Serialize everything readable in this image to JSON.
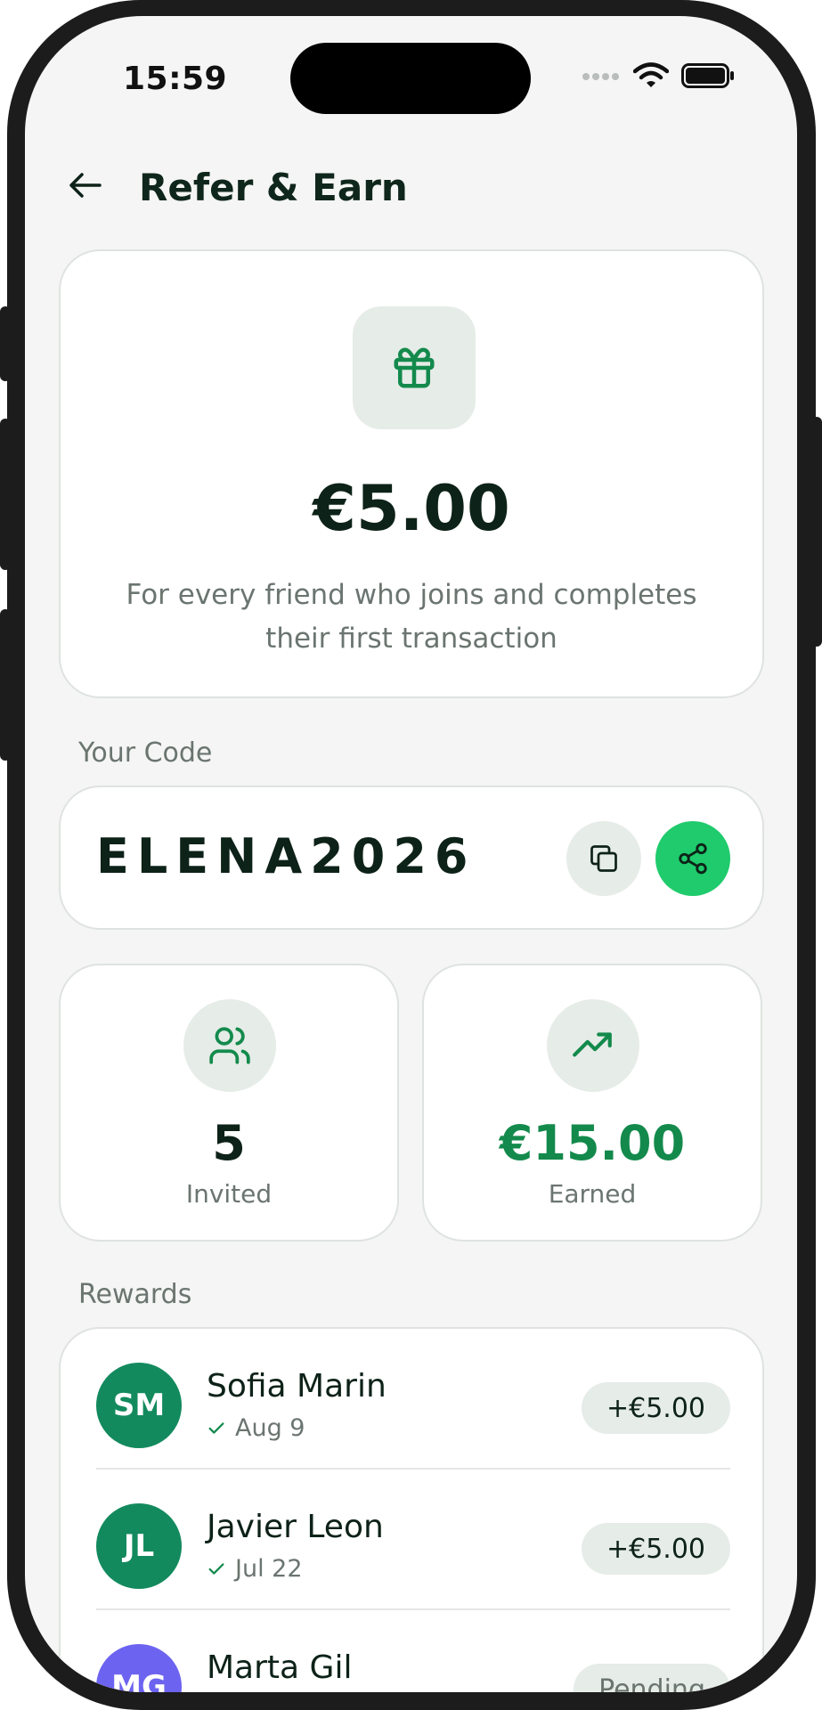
{
  "status_bar": {
    "time": "15:59"
  },
  "header": {
    "title": "Refer & Earn"
  },
  "hero": {
    "amount": "€5.00",
    "description": "For every friend who joins and completes their first transaction"
  },
  "code_section": {
    "label": "Your Code",
    "code": "ELENA2026"
  },
  "stats": {
    "invited": {
      "value": "5",
      "label": "Invited"
    },
    "earned": {
      "value": "€15.00",
      "label": "Earned"
    }
  },
  "rewards": {
    "label": "Rewards",
    "items": [
      {
        "initials": "SM",
        "name": "Sofia Marin",
        "date": "Aug 9",
        "amount": "+€5.00",
        "avatar_color": "#138a5e"
      },
      {
        "initials": "JL",
        "name": "Javier Leon",
        "date": "Jul 22",
        "amount": "+€5.00",
        "avatar_color": "#138a5e"
      },
      {
        "initials": "MG",
        "name": "Marta Gil",
        "date": "",
        "amount": "Pending",
        "avatar_color": "#6c63f0"
      }
    ]
  },
  "colors": {
    "accent": "#1fcb6c",
    "accent_dark": "#138a4c",
    "text": "#0d2218",
    "muted": "#6b7570"
  }
}
